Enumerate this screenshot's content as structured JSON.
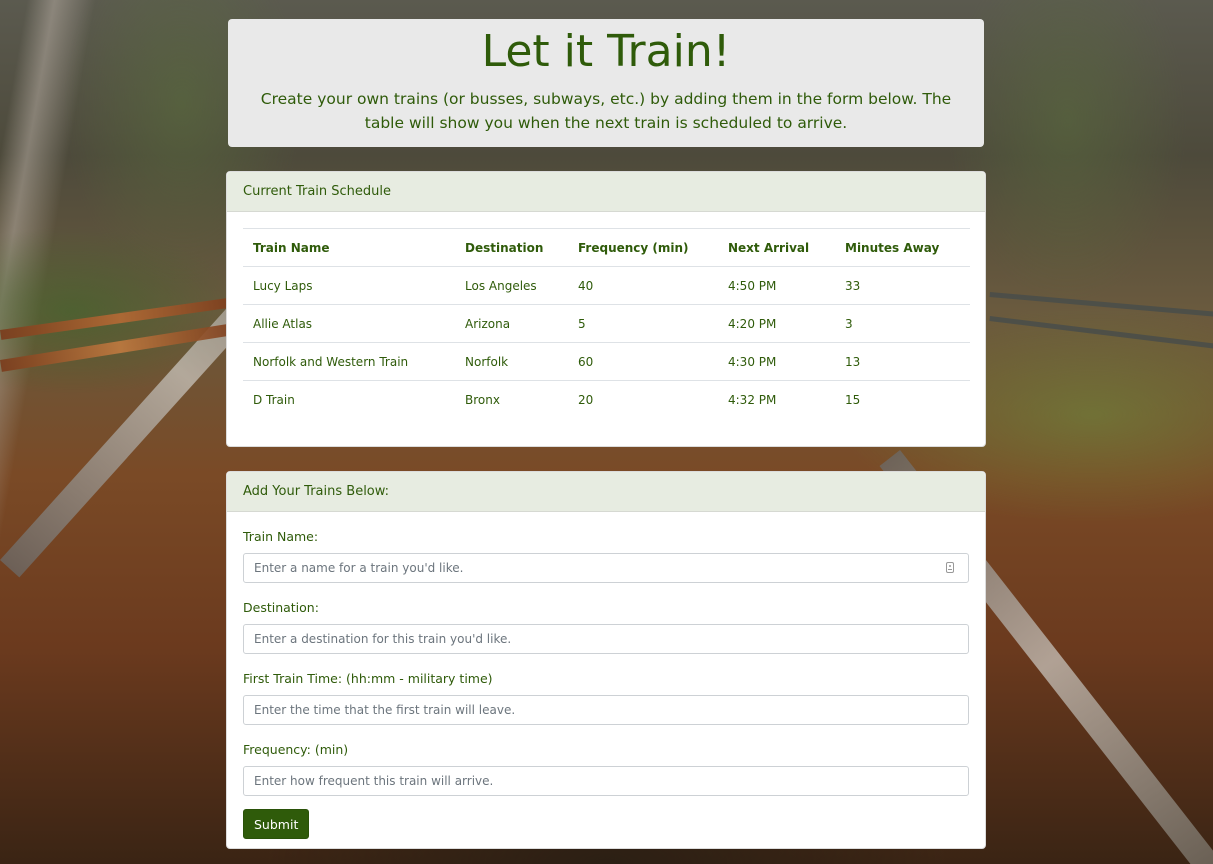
{
  "header": {
    "title": "Let it Train!",
    "subtitle": "Create your own trains (or busses, subways, etc.) by adding them in the form below. The table will show you when the next train is scheduled to arrive."
  },
  "schedule": {
    "heading": "Current Train Schedule",
    "columns": [
      "Train Name",
      "Destination",
      "Frequency (min)",
      "Next Arrival",
      "Minutes Away"
    ],
    "rows": [
      [
        "Lucy Laps",
        "Los Angeles",
        "40",
        "4:50 PM",
        "33"
      ],
      [
        "Allie Atlas",
        "Arizona",
        "5",
        "4:20 PM",
        "3"
      ],
      [
        "Norfolk and Western Train",
        "Norfolk",
        "60",
        "4:30 PM",
        "13"
      ],
      [
        "D Train",
        "Bronx",
        "20",
        "4:32 PM",
        "15"
      ]
    ]
  },
  "form": {
    "heading": "Add Your Trains Below:",
    "fields": [
      {
        "label": "Train Name:",
        "placeholder": "Enter a name for a train you'd like.",
        "value": ""
      },
      {
        "label": "Destination:",
        "placeholder": "Enter a destination for this train you'd like.",
        "value": ""
      },
      {
        "label": "First Train Time: (hh:mm - military time)",
        "placeholder": "Enter the time that the first train will leave.",
        "value": ""
      },
      {
        "label": "Frequency: (min)",
        "placeholder": "Enter how frequent this train will arrive.",
        "value": ""
      }
    ],
    "submit_label": "Submit",
    "autofill_icon": "contact-card-icon"
  },
  "colors": {
    "accent": "#2f5b0a",
    "card_header": "#e7ece1",
    "jumbotron": "#e9e9e9"
  }
}
